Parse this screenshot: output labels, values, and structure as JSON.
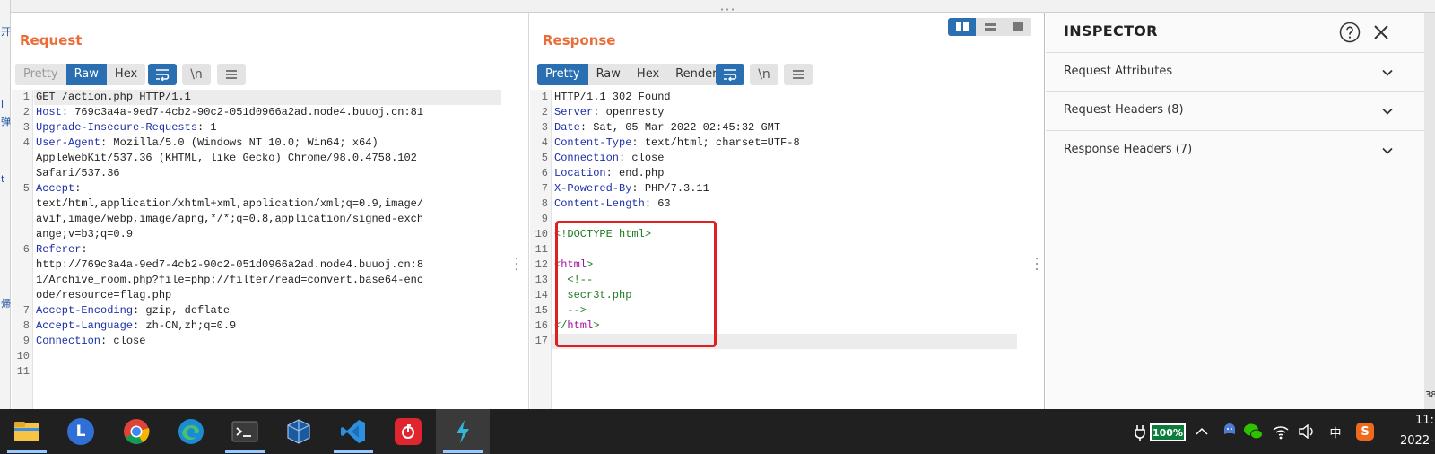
{
  "left_strip": {
    "chars": [
      "开",
      "l",
      "弹",
      "t",
      "帰"
    ]
  },
  "request": {
    "title": "Request",
    "tabs": [
      "Pretty",
      "Raw",
      "Hex"
    ],
    "active_tab": "Raw",
    "lines": [
      {
        "n": "1",
        "parts": [
          {
            "t": "GET /action.php HTTP/1.1",
            "c": ""
          }
        ]
      },
      {
        "n": "2",
        "parts": [
          {
            "t": "Host",
            "c": "hkey"
          },
          {
            "t": ": 769c3a4a-9ed7-4cb2-90c2-051d0966a2ad.node4.buuoj.cn:81",
            "c": ""
          }
        ]
      },
      {
        "n": "3",
        "parts": [
          {
            "t": "Upgrade-Insecure-Requests",
            "c": "hkey"
          },
          {
            "t": ": 1",
            "c": ""
          }
        ]
      },
      {
        "n": "4",
        "parts": [
          {
            "t": "User-Agent",
            "c": "hkey"
          },
          {
            "t": ": Mozilla/5.0 (Windows NT 10.0; Win64; x64)",
            "c": ""
          }
        ]
      },
      {
        "n": "",
        "parts": [
          {
            "t": "AppleWebKit/537.36 (KHTML, like Gecko) Chrome/98.0.4758.102",
            "c": ""
          }
        ]
      },
      {
        "n": "",
        "parts": [
          {
            "t": "Safari/537.36",
            "c": ""
          }
        ]
      },
      {
        "n": "5",
        "parts": [
          {
            "t": "Accept",
            "c": "hkey"
          },
          {
            "t": ":",
            "c": ""
          }
        ]
      },
      {
        "n": "",
        "parts": [
          {
            "t": "text/html,application/xhtml+xml,application/xml;q=0.9,image/",
            "c": ""
          }
        ]
      },
      {
        "n": "",
        "parts": [
          {
            "t": "avif,image/webp,image/apng,*/*;q=0.8,application/signed-exch",
            "c": ""
          }
        ]
      },
      {
        "n": "",
        "parts": [
          {
            "t": "ange;v=b3;q=0.9",
            "c": ""
          }
        ]
      },
      {
        "n": "6",
        "parts": [
          {
            "t": "Referer",
            "c": "hkey"
          },
          {
            "t": ":",
            "c": ""
          }
        ]
      },
      {
        "n": "",
        "parts": [
          {
            "t": "http://769c3a4a-9ed7-4cb2-90c2-051d0966a2ad.node4.buuoj.cn:8",
            "c": ""
          }
        ]
      },
      {
        "n": "",
        "parts": [
          {
            "t": "1/Archive_room.php?file=php://filter/read=convert.base64-enc",
            "c": ""
          }
        ]
      },
      {
        "n": "",
        "parts": [
          {
            "t": "ode/resource=flag.php",
            "c": ""
          }
        ]
      },
      {
        "n": "7",
        "parts": [
          {
            "t": "Accept-Encoding",
            "c": "hkey"
          },
          {
            "t": ": gzip, deflate",
            "c": ""
          }
        ]
      },
      {
        "n": "8",
        "parts": [
          {
            "t": "Accept-Language",
            "c": "hkey"
          },
          {
            "t": ": zh-CN,zh;q=0.9",
            "c": ""
          }
        ]
      },
      {
        "n": "9",
        "parts": [
          {
            "t": "Connection",
            "c": "hkey"
          },
          {
            "t": ": close",
            "c": ""
          }
        ]
      },
      {
        "n": "10",
        "parts": []
      },
      {
        "n": "11",
        "parts": []
      }
    ]
  },
  "response": {
    "title": "Response",
    "tabs": [
      "Pretty",
      "Raw",
      "Hex",
      "Render"
    ],
    "active_tab": "Pretty",
    "lines": [
      {
        "n": "1",
        "parts": [
          {
            "t": "HTTP/1.1 302 Found",
            "c": ""
          }
        ]
      },
      {
        "n": "2",
        "parts": [
          {
            "t": "Server",
            "c": "hkey"
          },
          {
            "t": ": openresty",
            "c": ""
          }
        ]
      },
      {
        "n": "3",
        "parts": [
          {
            "t": "Date",
            "c": "hkey"
          },
          {
            "t": ": Sat, 05 Mar 2022 02:45:32 GMT",
            "c": ""
          }
        ]
      },
      {
        "n": "4",
        "parts": [
          {
            "t": "Content-Type",
            "c": "hkey"
          },
          {
            "t": ": text/html; charset=UTF-8",
            "c": ""
          }
        ]
      },
      {
        "n": "5",
        "parts": [
          {
            "t": "Connection",
            "c": "hkey"
          },
          {
            "t": ": close",
            "c": ""
          }
        ]
      },
      {
        "n": "6",
        "parts": [
          {
            "t": "Location",
            "c": "hkey"
          },
          {
            "t": ": end.php",
            "c": ""
          }
        ]
      },
      {
        "n": "7",
        "parts": [
          {
            "t": "X-Powered-By",
            "c": "hkey"
          },
          {
            "t": ": PHP/7.3.11",
            "c": ""
          }
        ]
      },
      {
        "n": "8",
        "parts": [
          {
            "t": "Content-Length",
            "c": "hkey"
          },
          {
            "t": ": 63",
            "c": ""
          }
        ]
      },
      {
        "n": "9",
        "parts": []
      },
      {
        "n": "10",
        "parts": [
          {
            "t": "<!DOCTYPE html>",
            "c": "dt"
          }
        ]
      },
      {
        "n": "11",
        "parts": []
      },
      {
        "n": "12",
        "parts": [
          {
            "t": "<",
            "c": "dt"
          },
          {
            "t": "html",
            "c": "tag"
          },
          {
            "t": ">",
            "c": "dt"
          }
        ]
      },
      {
        "n": "13",
        "parts": [
          {
            "t": "  <!--",
            "c": "com"
          }
        ]
      },
      {
        "n": "14",
        "parts": [
          {
            "t": "  secr3t.php",
            "c": "com"
          }
        ]
      },
      {
        "n": "15",
        "parts": [
          {
            "t": "  -->",
            "c": "com"
          }
        ]
      },
      {
        "n": "16",
        "parts": [
          {
            "t": "</",
            "c": "dt"
          },
          {
            "t": "html",
            "c": "tag"
          },
          {
            "t": ">",
            "c": "dt"
          }
        ]
      },
      {
        "n": "17",
        "parts": []
      }
    ]
  },
  "toolbar": {
    "wrap_icon": "word-wrap-icon",
    "newline_label": "\\n",
    "menu_icon": "hamburger-menu-icon"
  },
  "inspector": {
    "title": "INSPECTOR",
    "sections": [
      {
        "label": "Request Attributes"
      },
      {
        "label": "Request Headers (8)"
      },
      {
        "label": "Response Headers (7)"
      }
    ]
  },
  "taskbar": {
    "apps": [
      {
        "name": "file-explorer-icon",
        "letter": ""
      },
      {
        "name": "lark-l-icon",
        "letter": "L"
      },
      {
        "name": "chrome-icon",
        "letter": ""
      },
      {
        "name": "edge-icon",
        "letter": ""
      },
      {
        "name": "terminal-icon",
        "letter": ""
      },
      {
        "name": "virtualbox-icon",
        "letter": ""
      },
      {
        "name": "vscode-icon",
        "letter": ""
      },
      {
        "name": "netease-music-icon",
        "letter": ""
      },
      {
        "name": "burp-suite-icon",
        "letter": ""
      }
    ],
    "battery": "100%",
    "ime": "中",
    "sogou": "S",
    "time": "11:",
    "date": "2022-"
  },
  "right_sliver_text": "38",
  "colors": {
    "accent": "#2b6fb3",
    "title_orange": "#ec6c38",
    "header_key": "#1b2fa8",
    "highlight_box": "#e02020"
  }
}
